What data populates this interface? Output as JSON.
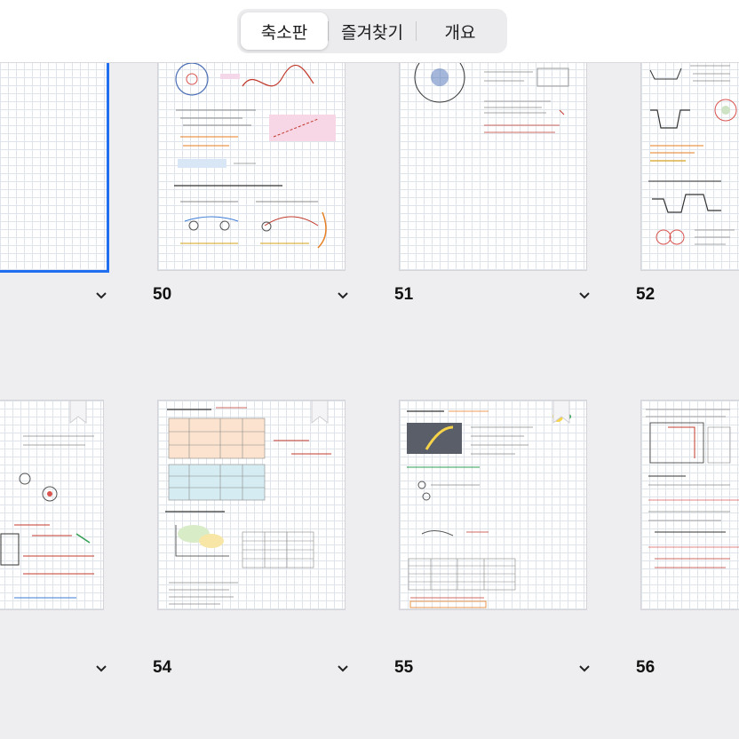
{
  "toolbar": {
    "segments": [
      {
        "label": "축소판",
        "active": true
      },
      {
        "label": "즐겨찾기",
        "active": false
      },
      {
        "label": "개요",
        "active": false
      }
    ]
  },
  "pages": [
    {
      "number": "",
      "selected": true
    },
    {
      "number": "50"
    },
    {
      "number": "51"
    },
    {
      "number": "52"
    },
    {
      "number": "",
      "bookmarked": true
    },
    {
      "number": "54",
      "bookmarked": true
    },
    {
      "number": "55",
      "bookmarked": true
    },
    {
      "number": "56"
    }
  ],
  "colors": {
    "accent": "#1f6ff0",
    "page_bg": "#ffffff",
    "grid_line": "#dfe3ea",
    "background": "#eeeef0"
  },
  "icons": {
    "page_menu": "chevron-down-icon",
    "bookmark": "bookmark-icon"
  }
}
